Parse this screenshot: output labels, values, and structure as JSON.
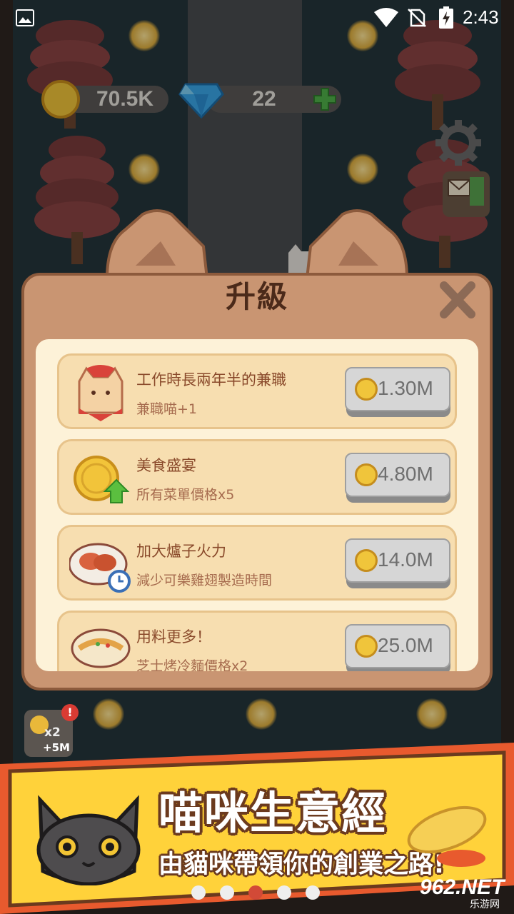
{
  "status_bar": {
    "time": "2:43"
  },
  "hud": {
    "coins": "70.5K",
    "gems": "22"
  },
  "dialog": {
    "title": "升級",
    "items": [
      {
        "name": "工作時長兩年半的兼職",
        "desc": "兼職喵+1",
        "price": "1.30M",
        "icon": "cat-worker-icon"
      },
      {
        "name": "美食盛宴",
        "desc": "所有菜單價格x5",
        "price": "4.80M",
        "icon": "coin-up-icon"
      },
      {
        "name": "加大爐子火力",
        "desc": "減少可樂雞翅製造時間",
        "price": "14.0M",
        "icon": "chicken-wings-icon"
      },
      {
        "name": "用料更多！",
        "desc": "芝士烤冷麵價格x2",
        "price": "25.0M",
        "icon": "noodle-bowl-icon"
      }
    ]
  },
  "boost": {
    "multiplier": "x2",
    "bonus": "+5M",
    "alert": "!"
  },
  "banner": {
    "title": "喵咪生意經",
    "subtitle": "由貓咪帶領你的創業之路!"
  },
  "carousel": {
    "count": 5,
    "active_index": 2
  },
  "watermark": {
    "brand": "962.NET",
    "sub": "乐游网"
  },
  "colors": {
    "panel": "#c99572",
    "inner": "#fdf2d8",
    "row": "#f7deb0",
    "banner": "#ffd23a",
    "active_dot": "#d24a37"
  }
}
